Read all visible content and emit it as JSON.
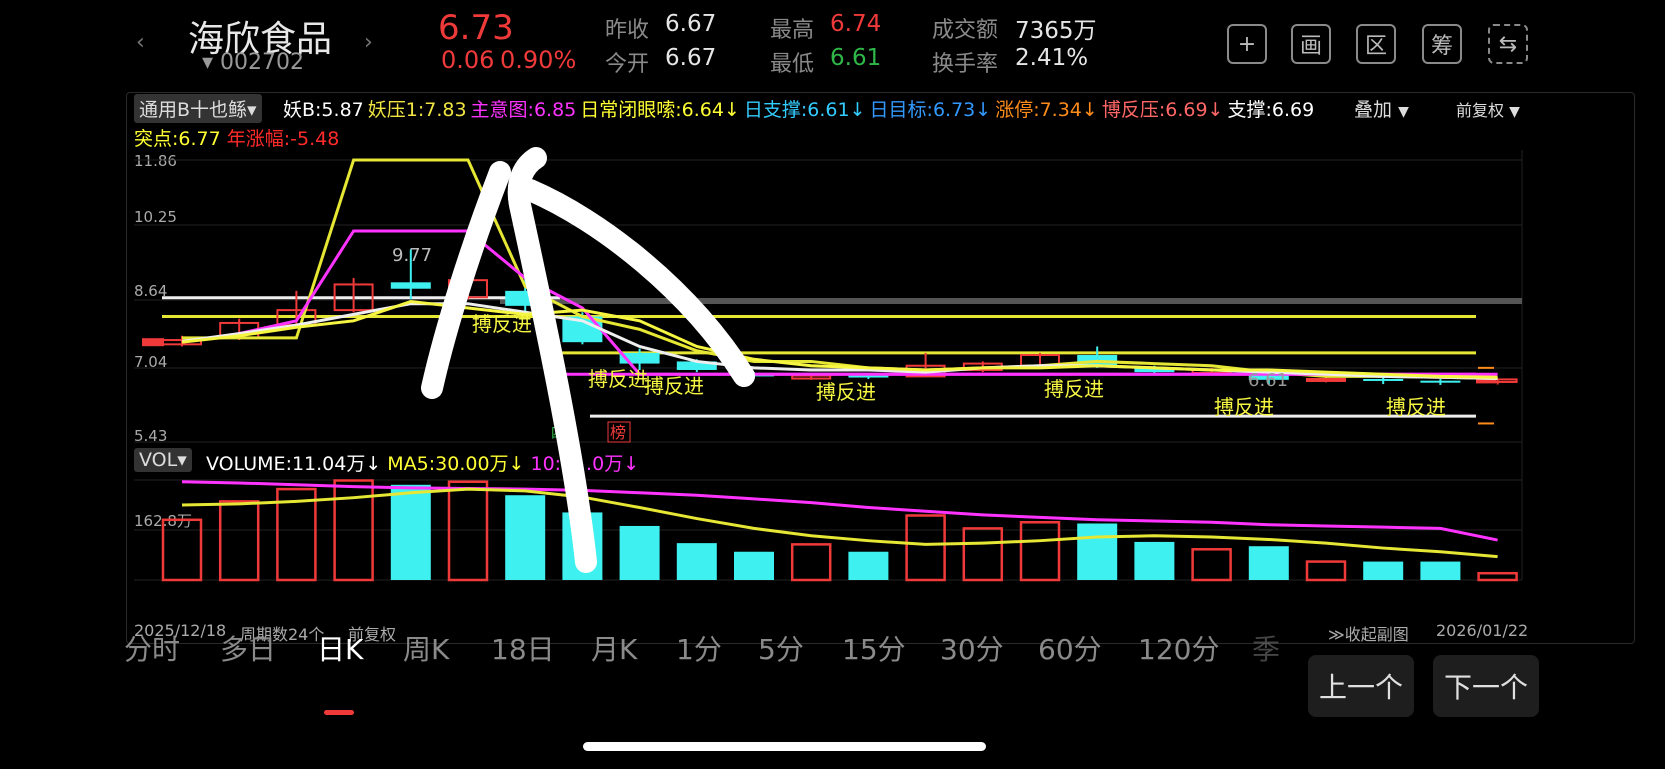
{
  "header": {
    "prev_arrow": "‹",
    "next_arrow": "›",
    "stock_name": "海欣食品",
    "code_prefix": "▾",
    "stock_code": "002702",
    "price": "6.73",
    "change": "0.06",
    "change_pct": "0.90%",
    "stats": [
      {
        "label": "昨收",
        "value": "6.67",
        "color": "#e6e6e6"
      },
      {
        "label": "今开",
        "value": "6.67",
        "color": "#e6e6e6"
      },
      {
        "label": "最高",
        "value": "6.74",
        "color": "#f03a3a"
      },
      {
        "label": "最低",
        "value": "6.61",
        "color": "#2fb84a"
      },
      {
        "label": "成交额",
        "value": "7365万",
        "color": "#e6e6e6"
      },
      {
        "label": "换手率",
        "value": "2.41%",
        "color": "#e6e6e6"
      }
    ],
    "tools": [
      "+",
      "画",
      "区",
      "筹",
      "⇆"
    ]
  },
  "indicator": {
    "selector": "通用B十也鲧",
    "items": [
      {
        "text": "妖B:5.87",
        "color": "#ffffff"
      },
      {
        "text": "妖压1:7.83",
        "color": "#f0e442"
      },
      {
        "text": "主意图:6.85",
        "color": "#ff33ff"
      },
      {
        "text": "日常闭眼嗦:6.64↓",
        "color": "#ffff33"
      },
      {
        "text": "日支撑:6.61↓",
        "color": "#33ccff"
      },
      {
        "text": "日目标:6.73↓",
        "color": "#3399ff"
      },
      {
        "text": "涨停:7.34↓",
        "color": "#ff8c1a"
      },
      {
        "text": "博反压:6.69↓",
        "color": "#ff6666"
      },
      {
        "text": "支撑:6.69",
        "color": "#ffffff"
      }
    ],
    "line2": [
      {
        "text": "突点:6.77",
        "color": "#ffff33"
      },
      {
        "text": "年涨幅:-5.48",
        "color": "#ff2a2a"
      }
    ],
    "overlay_label": "叠加",
    "adjust_label": "前复权"
  },
  "price_axis": [
    "11.86",
    "10.25",
    "8.64",
    "7.04",
    "5.43"
  ],
  "annotations": {
    "peak": "9.77",
    "low": "6.61",
    "signal": "搏反进",
    "tag_red": "榜",
    "tag_green": "四"
  },
  "volume": {
    "selector": "VOL",
    "items": [
      {
        "text": "VOLUME:11.04万↓",
        "color": "#ffffff"
      },
      {
        "text": "MA5:30.00万↓",
        "color": "#ffff33"
      },
      {
        "text": "10:5…0万↓",
        "color": "#ff33ff"
      }
    ],
    "axis_top": "162.8万"
  },
  "footer": {
    "start_date": "2025/12/18",
    "period_count": "周期数24个",
    "adjust": "前复权",
    "collapse": "≫收起副图",
    "end_date": "2026/01/22"
  },
  "tabs": [
    "分时",
    "多日",
    "日K",
    "周K",
    "18日",
    "月K",
    "1分",
    "5分",
    "15分",
    "30分",
    "60分",
    "120分",
    "季"
  ],
  "active_tab": 2,
  "prev_button": "上一个",
  "next_button": "下一个",
  "chart_data": {
    "type": "candlestick",
    "y_range": [
      5.43,
      11.86
    ],
    "volume_max_wan": 162.8,
    "candles": [
      {
        "o": 7.55,
        "c": 7.65,
        "h": 7.75,
        "l": 7.5,
        "v": 98
      },
      {
        "o": 7.7,
        "c": 8.05,
        "h": 8.15,
        "l": 7.65,
        "v": 128
      },
      {
        "o": 8.0,
        "c": 8.35,
        "h": 8.8,
        "l": 7.95,
        "v": 148
      },
      {
        "o": 8.35,
        "c": 8.95,
        "h": 9.1,
        "l": 8.3,
        "v": 162
      },
      {
        "o": 9.0,
        "c": 8.85,
        "h": 9.77,
        "l": 8.6,
        "v": 155
      },
      {
        "o": 8.65,
        "c": 9.05,
        "h": 9.4,
        "l": 8.6,
        "v": 160
      },
      {
        "o": 8.8,
        "c": 8.45,
        "h": 9.15,
        "l": 8.3,
        "v": 138
      },
      {
        "o": 8.2,
        "c": 7.6,
        "h": 8.3,
        "l": 7.55,
        "v": 110
      },
      {
        "o": 7.35,
        "c": 7.1,
        "h": 7.45,
        "l": 6.95,
        "v": 88
      },
      {
        "o": 7.15,
        "c": 6.95,
        "h": 7.2,
        "l": 6.9,
        "v": 60
      },
      {
        "o": 6.85,
        "c": 6.8,
        "h": 6.9,
        "l": 6.75,
        "v": 46
      },
      {
        "o": 6.75,
        "c": 6.82,
        "h": 6.88,
        "l": 6.72,
        "v": 58
      },
      {
        "o": 6.82,
        "c": 6.78,
        "h": 6.86,
        "l": 6.74,
        "v": 46
      },
      {
        "o": 6.8,
        "c": 7.05,
        "h": 7.35,
        "l": 6.78,
        "v": 105
      },
      {
        "o": 6.95,
        "c": 7.1,
        "h": 7.15,
        "l": 6.9,
        "v": 84
      },
      {
        "o": 7.05,
        "c": 7.3,
        "h": 7.35,
        "l": 7.0,
        "v": 94
      },
      {
        "o": 7.3,
        "c": 7.05,
        "h": 7.5,
        "l": 7.0,
        "v": 92
      },
      {
        "o": 7.0,
        "c": 6.9,
        "h": 7.05,
        "l": 6.85,
        "v": 62
      },
      {
        "o": 6.88,
        "c": 6.95,
        "h": 7.0,
        "l": 6.82,
        "v": 50
      },
      {
        "o": 6.85,
        "c": 6.72,
        "h": 6.9,
        "l": 6.61,
        "v": 55
      },
      {
        "o": 6.7,
        "c": 6.74,
        "h": 6.8,
        "l": 6.66,
        "v": 30
      },
      {
        "o": 6.74,
        "c": 6.7,
        "h": 6.78,
        "l": 6.62,
        "v": 30
      },
      {
        "o": 6.7,
        "c": 6.66,
        "h": 6.74,
        "l": 6.6,
        "v": 30
      },
      {
        "o": 6.67,
        "c": 6.73,
        "h": 6.74,
        "l": 6.61,
        "v": 11.04
      }
    ]
  }
}
